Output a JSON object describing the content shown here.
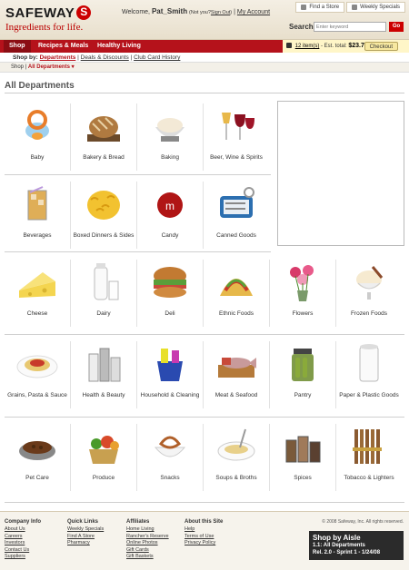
{
  "header": {
    "logo_text": "SAFEWAY",
    "tagline": "Ingredients for life.",
    "welcome_prefix": "Welcome,",
    "user_name": "Pat_Smith",
    "not_you": "(Not you?",
    "sign_out": "Sign Out",
    "not_you_close": ")",
    "account_link": "My Account",
    "find_store": "Find a Store",
    "weekly_specials": "Weekly Specials",
    "search_label": "Search",
    "search_placeholder": "Enter keyword",
    "go_label": "Go"
  },
  "nav": {
    "items": [
      {
        "label": "Shop"
      },
      {
        "label": "Recipes & Meals"
      },
      {
        "label": "Healthy Living"
      }
    ]
  },
  "cart": {
    "items": "12 item(s)",
    "est_label": "- Est. total:",
    "total": "$23.79",
    "checkout": "Checkout"
  },
  "shopby": {
    "label": "Shop by:",
    "current": "Departments",
    "links": [
      "Deals & Discounts",
      "Club Card History"
    ]
  },
  "breadcrumb": {
    "root": "Shop",
    "current": "All Departments ▾"
  },
  "page_title": "All Departments",
  "departments": [
    {
      "label": "Baby",
      "icon": "baby-pacifier-icon"
    },
    {
      "label": "Bakery & Bread",
      "icon": "bread-loaf-icon"
    },
    {
      "label": "Baking",
      "icon": "flour-bowl-icon"
    },
    {
      "label": "Beer, Wine & Spirits",
      "icon": "wine-glasses-icon"
    },
    {
      "label": "Beverages",
      "icon": "iced-drink-icon"
    },
    {
      "label": "Boxed Dinners & Sides",
      "icon": "macaroni-icon"
    },
    {
      "label": "Candy",
      "icon": "candy-icon"
    },
    {
      "label": "Canned Goods",
      "icon": "sardine-can-icon"
    },
    {
      "label": "Cheese",
      "icon": "cheese-wedge-icon"
    },
    {
      "label": "Dairy",
      "icon": "milk-bottle-icon"
    },
    {
      "label": "Deli",
      "icon": "sandwich-icon"
    },
    {
      "label": "Ethnic Foods",
      "icon": "taco-icon"
    },
    {
      "label": "Flowers",
      "icon": "flower-vase-icon"
    },
    {
      "label": "Frozen Foods",
      "icon": "ice-cream-icon"
    },
    {
      "label": "Grains, Pasta & Sauce",
      "icon": "spaghetti-icon"
    },
    {
      "label": "Health & Beauty",
      "icon": "lotion-bottles-icon"
    },
    {
      "label": "Household & Cleaning",
      "icon": "cleaning-bucket-icon"
    },
    {
      "label": "Meat & Seafood",
      "icon": "fish-board-icon"
    },
    {
      "label": "Pantry",
      "icon": "pickle-jar-icon"
    },
    {
      "label": "Paper & Plastic Goods",
      "icon": "paper-towel-icon"
    },
    {
      "label": "Pet Care",
      "icon": "pet-bowl-icon"
    },
    {
      "label": "Produce",
      "icon": "vegetable-basket-icon"
    },
    {
      "label": "Snacks",
      "icon": "pretzel-bowl-icon"
    },
    {
      "label": "Soups & Broths",
      "icon": "soup-bowl-icon"
    },
    {
      "label": "Spices",
      "icon": "spice-jars-icon"
    },
    {
      "label": "Tobacco & Lighters",
      "icon": "cigars-icon"
    }
  ],
  "footer": {
    "columns": [
      {
        "heading": "Company Info",
        "links": [
          "About Us",
          "Careers",
          "Investors",
          "Contact Us",
          "Suppliers"
        ]
      },
      {
        "heading": "Quick Links",
        "links": [
          "Weekly Specials",
          "Find A Store",
          "Pharmacy"
        ]
      },
      {
        "heading": "Affiliates",
        "links": [
          "Home Living",
          "Rancher's Reserve",
          "Online Photos",
          "Gift Cards",
          "Gift Baskets"
        ]
      },
      {
        "heading": "About this Site",
        "links": [
          "Help",
          "Terms of Use",
          "Privacy Policy"
        ]
      }
    ],
    "copyright": "© 2008 Safeway, Inc. All rights reserved.",
    "aisle_title": "Shop by Aisle",
    "aisle_line1": "1.1: All Departments",
    "aisle_line2": "Rel. 2.0 - Sprint 1 - 1/24/08"
  },
  "colors": {
    "brand_red": "#b5121b",
    "header_bg": "#f4efe4"
  }
}
